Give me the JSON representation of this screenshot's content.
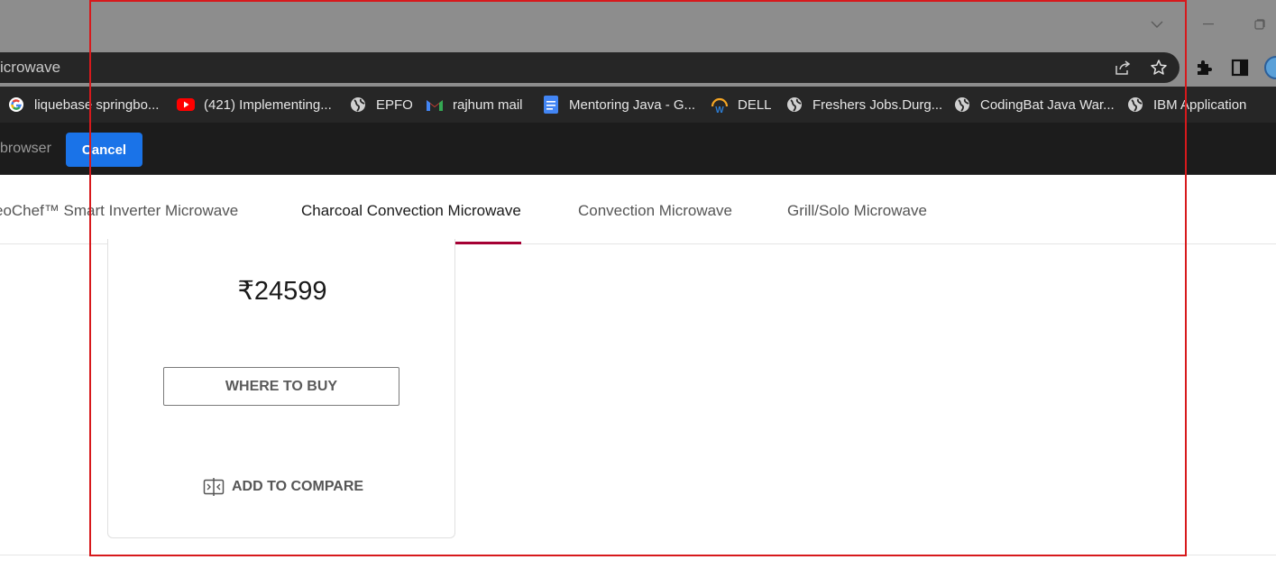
{
  "browser": {
    "omnibox_text": "icrowave",
    "bookmarks": [
      {
        "label": "liquebase springbo...",
        "icon": "google-icon"
      },
      {
        "label": "(421) Implementing...",
        "icon": "youtube-icon"
      },
      {
        "label": "EPFO",
        "icon": "globe-icon"
      },
      {
        "label": "rajhum mail",
        "icon": "gmail-icon"
      },
      {
        "label": "Mentoring Java - G...",
        "icon": "docs-icon"
      },
      {
        "label": "DELL",
        "icon": "dell-icon"
      },
      {
        "label": "Freshers Jobs.Durg...",
        "icon": "globe-icon"
      },
      {
        "label": "CodingBat Java War...",
        "icon": "globe-icon"
      },
      {
        "label": "IBM Application",
        "icon": "globe-icon"
      }
    ],
    "infobar": {
      "text": "browser",
      "cancel_label": "Cancel"
    }
  },
  "page": {
    "tabs": [
      {
        "label": "eoChef™ Smart Inverter Microwave",
        "active": false
      },
      {
        "label": "Charcoal Convection Microwave",
        "active": true
      },
      {
        "label": "Convection Microwave",
        "active": false
      },
      {
        "label": "Grill/Solo Microwave",
        "active": false
      }
    ],
    "product": {
      "price": "₹24599",
      "where_to_buy_label": "WHERE TO BUY",
      "add_to_compare_label": "ADD TO COMPARE"
    }
  },
  "colors": {
    "accent_tab_underline": "#a50034",
    "cancel_button": "#1a73e8",
    "annotation_frame": "#d7191c"
  }
}
